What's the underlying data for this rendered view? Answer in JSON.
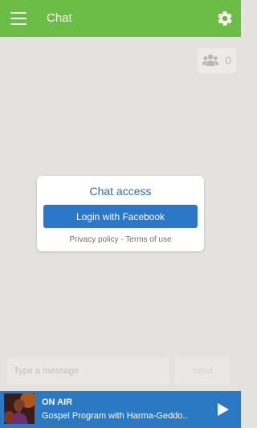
{
  "header": {
    "title": "Chat",
    "menu_icon": "hamburger-menu-icon",
    "settings_icon": "gear-icon"
  },
  "users": {
    "icon": "users-icon",
    "count": "0"
  },
  "dialog": {
    "title": "Chat access",
    "login_button": "Login with Facebook",
    "privacy_link": "Privacy policy",
    "separator": " - ",
    "terms_link": "Terms of use"
  },
  "composer": {
    "placeholder": "Type a message",
    "send_label": "Send"
  },
  "player": {
    "status": "ON AIR",
    "program": "Gospel Program with Harma-Geddo..",
    "play_icon": "play-icon"
  },
  "colors": {
    "header": "#6cbd45",
    "background": "#e4e2df",
    "button": "#2b77c8",
    "player": "#2b79c2",
    "dialog_title": "#2f6bb2"
  }
}
